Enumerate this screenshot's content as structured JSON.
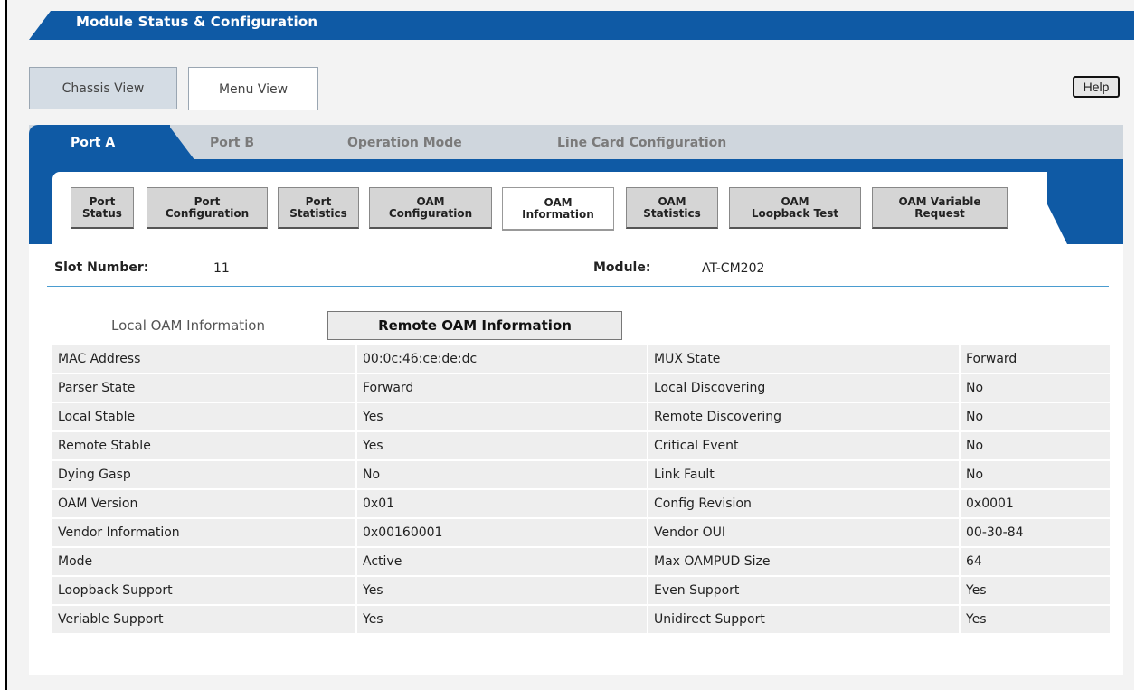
{
  "header": {
    "title": "Module Status & Configuration"
  },
  "view_tabs": [
    {
      "label": "Chassis View",
      "active": false
    },
    {
      "label": "Menu View",
      "active": true
    }
  ],
  "help_label": "Help",
  "port_tabs": [
    {
      "label": "Port A",
      "active": true
    },
    {
      "label": "Port B",
      "active": false
    },
    {
      "label": "Operation Mode",
      "active": false
    },
    {
      "label": "Line Card Configuration",
      "active": false
    }
  ],
  "sub_tabs": [
    {
      "line1": "Port",
      "line2": "Status"
    },
    {
      "line1": "Port",
      "line2": "Configuration"
    },
    {
      "line1": "Port",
      "line2": "Statistics"
    },
    {
      "line1": "OAM",
      "line2": "Configuration"
    },
    {
      "line1": "OAM",
      "line2": "Information",
      "active": true
    },
    {
      "line1": "OAM",
      "line2": "Statistics"
    },
    {
      "line1": "OAM",
      "line2": "Loopback Test"
    },
    {
      "line1": "OAM Variable",
      "line2": "Request"
    }
  ],
  "slot": {
    "label": "Slot Number:",
    "value": "11"
  },
  "module": {
    "label": "Module:",
    "value": "AT-CM202"
  },
  "info_tabs": {
    "local": "Local OAM Information",
    "remote": "Remote OAM Information"
  },
  "rows": [
    [
      "MAC Address",
      "00:0c:46:ce:de:dc",
      "MUX State",
      "Forward"
    ],
    [
      "Parser State",
      "Forward",
      "Local Discovering",
      "No"
    ],
    [
      "Local Stable",
      "Yes",
      "Remote Discovering",
      "No"
    ],
    [
      "Remote Stable",
      "Yes",
      "Critical Event",
      "No"
    ],
    [
      "Dying Gasp",
      "No",
      "Link Fault",
      "No"
    ],
    [
      "OAM Version",
      "0x01",
      "Config Revision",
      "0x0001"
    ],
    [
      "Vendor Information",
      "0x00160001",
      "Vendor OUI",
      "00-30-84"
    ],
    [
      "Mode",
      "Active",
      "Max OAMPUD Size",
      "64"
    ],
    [
      "Loopback Support",
      "Yes",
      "Even Support",
      "Yes"
    ],
    [
      "Veriable Support",
      "Yes",
      "Unidirect Support",
      "Yes"
    ]
  ],
  "colors": {
    "brand_blue": "#0f5aa5",
    "accent_line": "#4a9cd0"
  }
}
